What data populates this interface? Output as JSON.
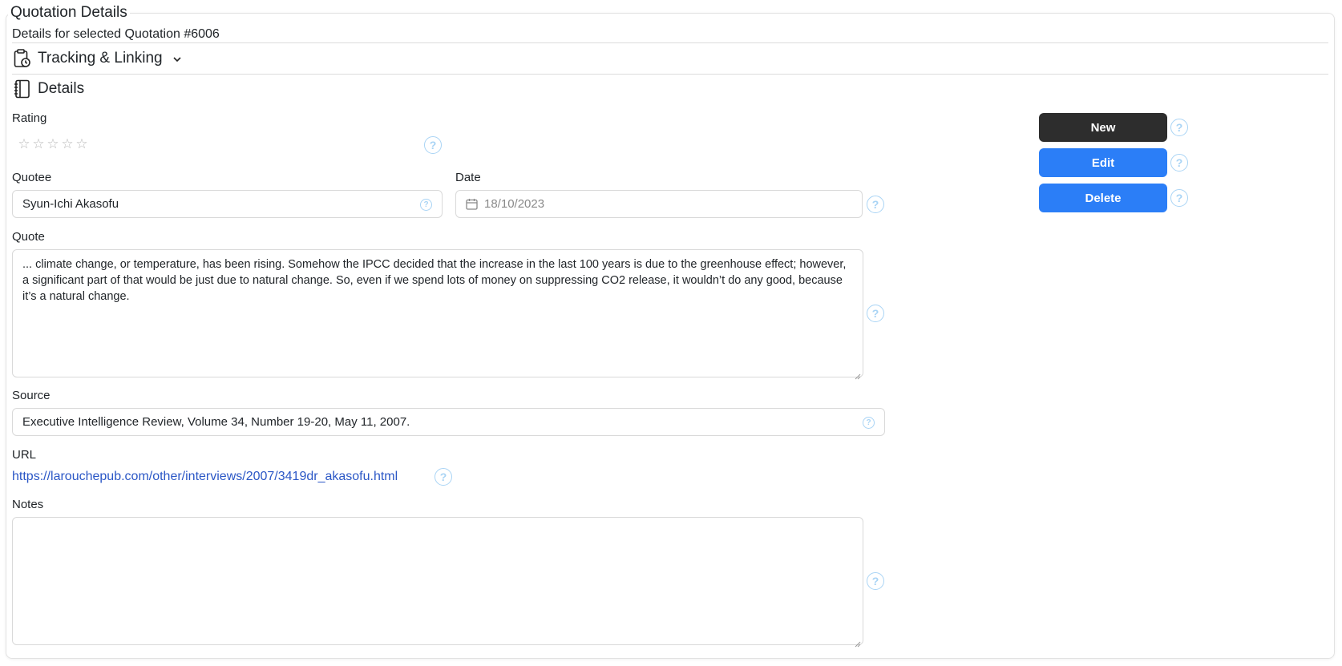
{
  "panel": {
    "legend": "Quotation Details",
    "subtitle": "Details for selected Quotation #6006"
  },
  "tracking": {
    "title": "Tracking & Linking",
    "icon": "clipboard-clock-icon",
    "expand_icon": "chevron-down-icon"
  },
  "details": {
    "title": "Details",
    "icon": "notebook-icon"
  },
  "rating": {
    "label": "Rating",
    "value": 0,
    "max": 5
  },
  "quotee": {
    "label": "Quotee",
    "value": "Syun-Ichi Akasofu"
  },
  "date": {
    "label": "Date",
    "value": "18/10/2023",
    "icon": "calendar-icon"
  },
  "quote": {
    "label": "Quote",
    "value": "... climate change, or temperature, has been rising. Somehow the IPCC decided that the increase in the last 100 years is due to the greenhouse effect; however, a significant part of that would be just due to natural change. So, even if we spend lots of money on suppressing CO2 release, it wouldn’t do any good, because it’s a natural change."
  },
  "source": {
    "label": "Source",
    "value": "Executive Intelligence Review, Volume 34, Number 19-20, May 11, 2007."
  },
  "url": {
    "label": "URL",
    "value": "https://larouchepub.com/other/interviews/2007/3419dr_akasofu.html"
  },
  "notes": {
    "label": "Notes",
    "value": ""
  },
  "actions": {
    "new_label": "New",
    "edit_label": "Edit",
    "delete_label": "Delete"
  },
  "help_glyph": "?",
  "colors": {
    "primary": "#2b7ef7",
    "dark": "#2d2d2d",
    "help": "#a9d4f5",
    "link": "#2b57c6"
  }
}
